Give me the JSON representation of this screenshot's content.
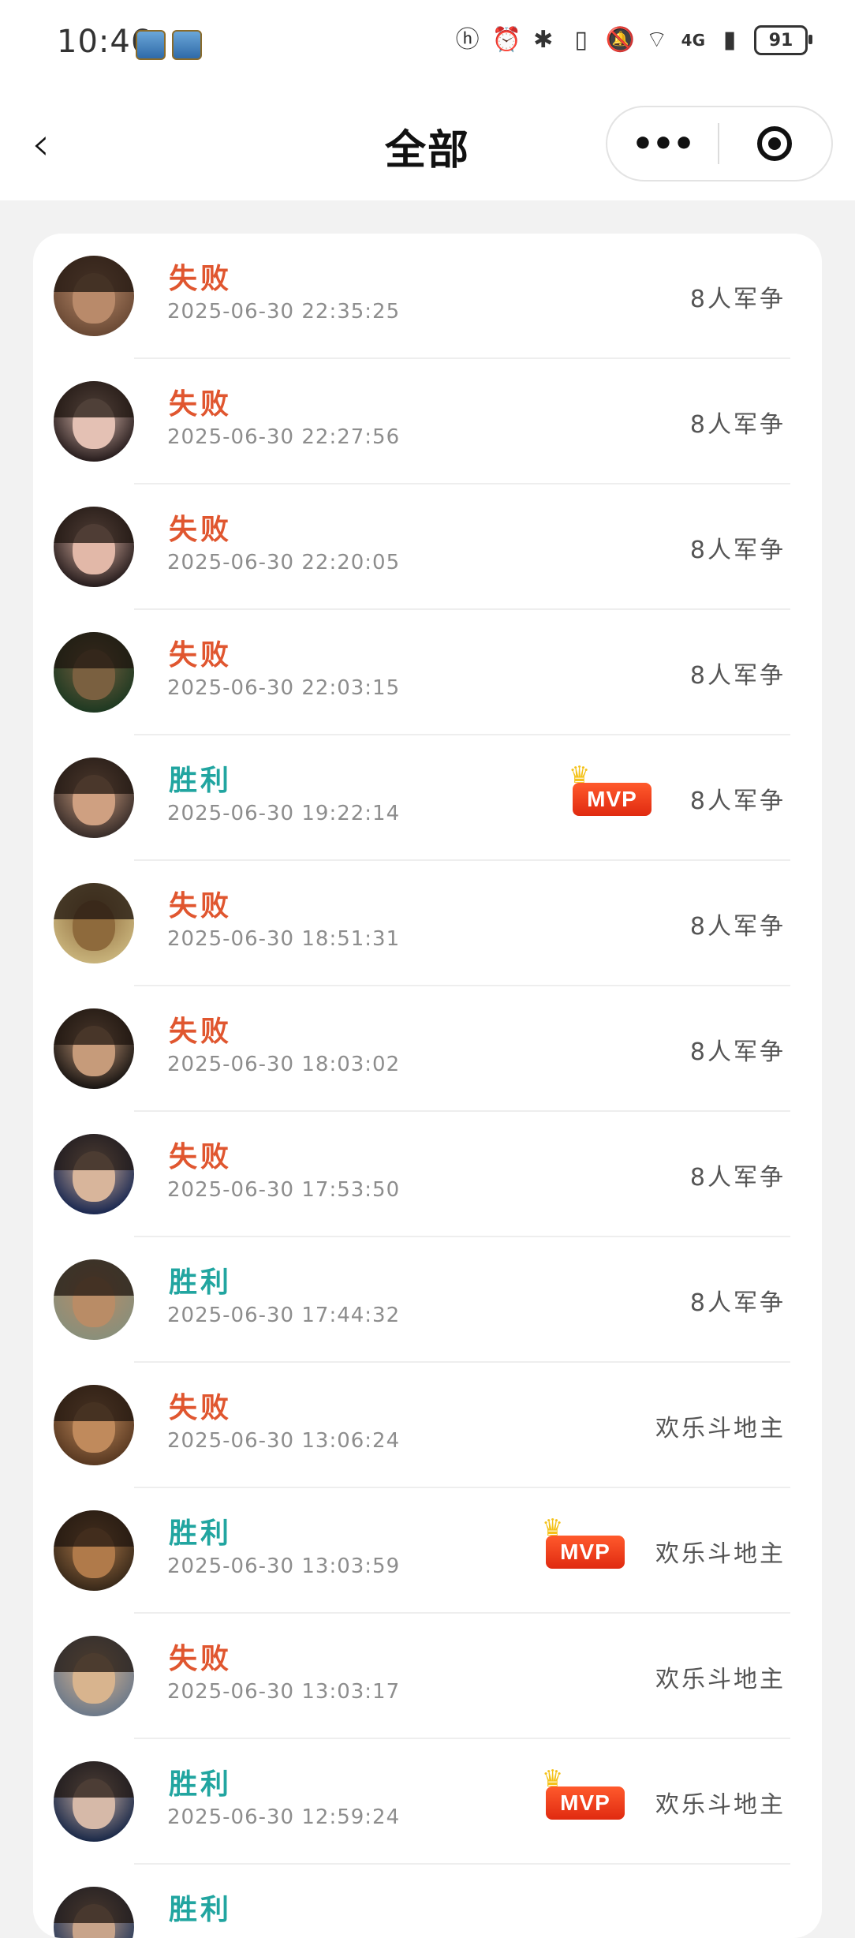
{
  "status_bar": {
    "time": "10:46",
    "icons": [
      "hd-icon",
      "alarm-icon",
      "bluetooth-icon",
      "vibrate-icon",
      "mute-icon",
      "wifi-icon",
      "signal-icon"
    ],
    "network_label": "4G",
    "battery": "91"
  },
  "nav": {
    "title": "全部",
    "more_label": "•••"
  },
  "mvp_label": "MVP",
  "records": [
    {
      "result": "失败",
      "status": "lose",
      "timestamp": "2025-06-30 22:35:25",
      "mode": "8人军争",
      "mvp": false,
      "avatar_colors": [
        "#6b4a35",
        "#b98a6a"
      ]
    },
    {
      "result": "失败",
      "status": "lose",
      "timestamp": "2025-06-30 22:27:56",
      "mode": "8人军争",
      "mvp": false,
      "avatar_colors": [
        "#2a1f1f",
        "#e4c1b4"
      ]
    },
    {
      "result": "失败",
      "status": "lose",
      "timestamp": "2025-06-30 22:20:05",
      "mode": "8人军争",
      "mvp": false,
      "avatar_colors": [
        "#2a1f1f",
        "#e2b8a8"
      ]
    },
    {
      "result": "失败",
      "status": "lose",
      "timestamp": "2025-06-30 22:03:15",
      "mode": "8人军争",
      "mvp": false,
      "avatar_colors": [
        "#1f3a22",
        "#7a6040"
      ]
    },
    {
      "result": "胜利",
      "status": "win",
      "timestamp": "2025-06-30 19:22:14",
      "mode": "8人军争",
      "mvp": true,
      "avatar_colors": [
        "#3a2e2a",
        "#cfa081"
      ]
    },
    {
      "result": "失败",
      "status": "lose",
      "timestamp": "2025-06-30 18:51:31",
      "mode": "8人军争",
      "mvp": false,
      "avatar_colors": [
        "#c7b27a",
        "#8e6a3c"
      ]
    },
    {
      "result": "失败",
      "status": "lose",
      "timestamp": "2025-06-30 18:03:02",
      "mode": "8人军争",
      "mvp": false,
      "avatar_colors": [
        "#1c1714",
        "#c69b7a"
      ]
    },
    {
      "result": "失败",
      "status": "lose",
      "timestamp": "2025-06-30 17:53:50",
      "mode": "8人军争",
      "mvp": false,
      "avatar_colors": [
        "#1d2a52",
        "#d8b59b"
      ]
    },
    {
      "result": "胜利",
      "status": "win",
      "timestamp": "2025-06-30 17:44:32",
      "mode": "8人军争",
      "mvp": false,
      "avatar_colors": [
        "#8a8f7a",
        "#b98c66"
      ]
    },
    {
      "result": "失败",
      "status": "lose",
      "timestamp": "2025-06-30 13:06:24",
      "mode": "欢乐斗地主",
      "mvp": false,
      "avatar_colors": [
        "#5a3a22",
        "#c08a5c"
      ]
    },
    {
      "result": "胜利",
      "status": "win",
      "timestamp": "2025-06-30 13:03:59",
      "mode": "欢乐斗地主",
      "mvp": true,
      "avatar_colors": [
        "#3a2a1a",
        "#b07a4a"
      ]
    },
    {
      "result": "失败",
      "status": "lose",
      "timestamp": "2025-06-30 13:03:17",
      "mode": "欢乐斗地主",
      "mvp": false,
      "avatar_colors": [
        "#6e7a8a",
        "#d8b48e"
      ]
    },
    {
      "result": "胜利",
      "status": "win",
      "timestamp": "2025-06-30 12:59:24",
      "mode": "欢乐斗地主",
      "mvp": true,
      "avatar_colors": [
        "#1d2b4a",
        "#d6b9a8"
      ]
    },
    {
      "result": "胜利",
      "status": "win",
      "timestamp": "",
      "mode": "",
      "mvp": false,
      "avatar_colors": [
        "#2a3a5a",
        "#c8a48a"
      ]
    }
  ]
}
